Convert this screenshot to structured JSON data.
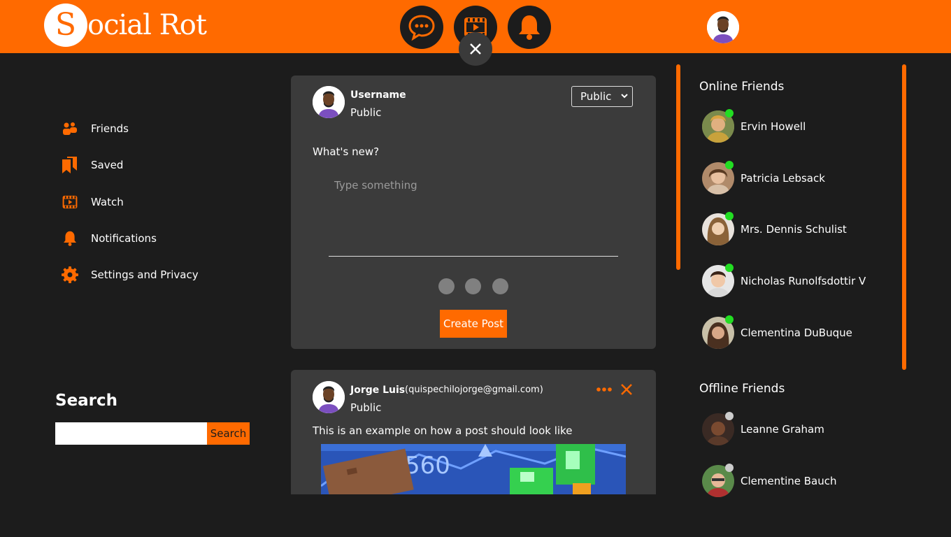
{
  "app": {
    "title_initial": "S",
    "title_rest": "ocial Rot"
  },
  "colors": {
    "accent": "#ff6a00",
    "background": "#1c1c1c",
    "card": "#3b3b3b",
    "online": "#22dd22",
    "offline": "#cccccc"
  },
  "header": {
    "icons": [
      "chat-icon",
      "video-icon",
      "bell-icon"
    ],
    "close_icon": "close-icon",
    "avatar": "user-avatar"
  },
  "sidebar": {
    "items": [
      {
        "label": "Friends",
        "icon": "friends-icon"
      },
      {
        "label": "Saved",
        "icon": "bookmark-icon"
      },
      {
        "label": "Watch",
        "icon": "video-icon"
      },
      {
        "label": "Notifications",
        "icon": "bell-icon"
      },
      {
        "label": "Settings and Privacy",
        "icon": "gear-icon"
      }
    ]
  },
  "search": {
    "title": "Search",
    "placeholder": "",
    "button_label": "Search"
  },
  "composer": {
    "username": "Username",
    "visibility": "Public",
    "select_value": "Public",
    "prompt": "What's new?",
    "placeholder": "Type something",
    "button_label": "Create Post"
  },
  "post": {
    "author": "Jorge Luis",
    "email": "(quispechilojorge@gmail.com)",
    "visibility": "Public",
    "text": "This is an example on how a post should look like",
    "image_text": "560"
  },
  "online_friends": {
    "title": "Online Friends",
    "items": [
      {
        "name": "Ervin Howell"
      },
      {
        "name": "Patricia Lebsack"
      },
      {
        "name": "Mrs. Dennis Schulist"
      },
      {
        "name": "Nicholas Runolfsdottir V"
      },
      {
        "name": "Clementina DuBuque"
      }
    ]
  },
  "offline_friends": {
    "title": "Offline Friends",
    "items": [
      {
        "name": "Leanne Graham"
      },
      {
        "name": "Clementine Bauch"
      }
    ]
  }
}
